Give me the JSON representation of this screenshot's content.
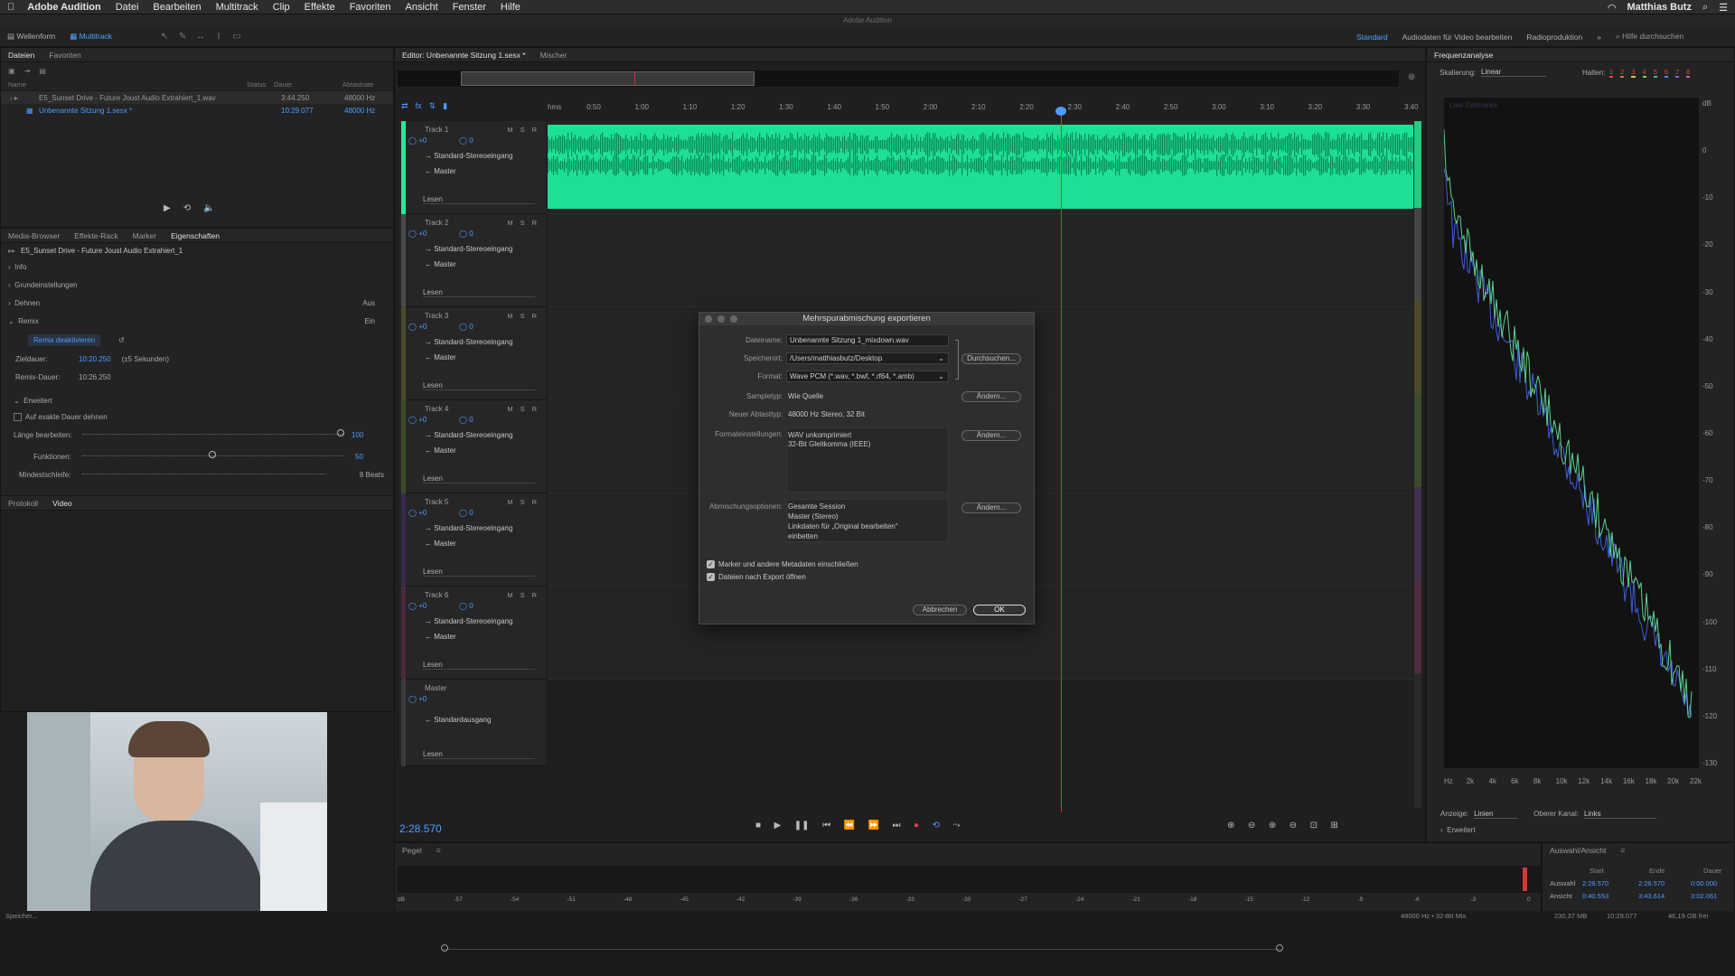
{
  "menubar": {
    "app": "Adobe Audition",
    "items": [
      "Datei",
      "Bearbeiten",
      "Multitrack",
      "Clip",
      "Effekte",
      "Favoriten",
      "Ansicht",
      "Fenster",
      "Hilfe"
    ],
    "user": "Matthias Butz"
  },
  "window_title": "Adobe Audition",
  "toolbar": {
    "waveform": "Wellenform",
    "multitrack": "Multitrack",
    "workspaces": [
      "Standard",
      "Audiodaten für Video bearbeiten",
      "Radioproduktion"
    ],
    "search_placeholder": "Hilfe durchsuchen"
  },
  "files_panel": {
    "tabs": [
      "Dateien",
      "Favoriten"
    ],
    "columns": [
      "Name",
      "Status",
      "Dauer",
      "Abtastrate"
    ],
    "rows": [
      {
        "name": "E5_Sunset Drive - Future Joust Audio Extrahiert_1.wav",
        "duration": "3:44.250",
        "rate": "48000 Hz"
      },
      {
        "name": "Unbenannte Sitzung 1.sesx *",
        "duration": "10:29.077",
        "rate": "48000 Hz"
      }
    ]
  },
  "props_panel": {
    "tabs": [
      "Media-Browser",
      "Effekte-Rack",
      "Marker",
      "Eigenschaften"
    ],
    "file": "E5_Sunset Drive - Future Joust Audio Extrahiert_1",
    "sections": [
      "Info",
      "Grundeinstellungen",
      "Dehnen",
      "Remix"
    ],
    "dehnen_value": "Aus",
    "remix_value": "Ein",
    "remix_button": "Remix deaktivieren",
    "zieldauer_label": "Zieldauer:",
    "zieldauer_value": "10:20.250",
    "zieldauer_note": "(±5 Sekunden)",
    "remixdauer_label": "Remix-Dauer:",
    "remixdauer_value": "10:26.250",
    "erweitert": "Erweitert",
    "exact_label": "Auf exakte Dauer dehnen",
    "length_label": "Länge bearbeiten:",
    "length_value": "100",
    "funktionen_label": "Funktionen:",
    "funktionen_value": "50",
    "mindest_label": "Mindestschleife:",
    "mindest_value": "8 Beats",
    "bottom_tabs": [
      "Protokoll",
      "Video"
    ]
  },
  "editor": {
    "tab": "Editor: Unbenannte Sitzung 1.sesx *",
    "mixer_tab": "Mischer",
    "ruler": [
      "hms",
      "0:50",
      "1:00",
      "1:10",
      "1:20",
      "1:30",
      "1:40",
      "1:50",
      "2:00",
      "2:10",
      "2:20",
      "2:30",
      "2:40",
      "2:50",
      "3:00",
      "3:10",
      "3:20",
      "3:30",
      "3:40"
    ],
    "tracks": [
      {
        "name": "Track 1",
        "color": "#2ee59a"
      },
      {
        "name": "Track 2",
        "color": "#4a4a4a"
      },
      {
        "name": "Track 3",
        "color": "#4a4a2a"
      },
      {
        "name": "Track 4",
        "color": "#3a4a2a"
      },
      {
        "name": "Track 5",
        "color": "#3a2a4a"
      },
      {
        "name": "Track 6",
        "color": "#4a2a3a"
      }
    ],
    "vol": "+0",
    "pan": "0",
    "input": "Standard-Stereoeingang",
    "output": "Master",
    "mode": "Lesen",
    "master_name": "Master",
    "master_output": "Standardausgang",
    "time": "2:28.570"
  },
  "dialog": {
    "title": "Mehrspurabmischung exportieren",
    "filename_label": "Dateiname:",
    "filename": "Unbenannte Sitzung 1_mixdown.wav",
    "location_label": "Speicherort:",
    "location": "/Users/matthiasbutz/Desktop",
    "browse": "Durchsuchen...",
    "format_label": "Format:",
    "format": "Wave PCM (*.wav, *.bwf, *.rf64, *.amb)",
    "sampletype_label": "Sampletyp:",
    "sampletype": "Wie Quelle",
    "newtype_label": "Neuer Abtasttyp:",
    "newtype": "48000 Hz Stereo, 32 Bit",
    "formatsettings_label": "Formateinstellungen:",
    "formatsettings": [
      "WAV unkomprimiert",
      "32-Bit Gleitkomma (IEEE)"
    ],
    "mixoptions_label": "Abmischungsoptionen:",
    "mixoptions": [
      "Gesamte Session",
      "Master (Stereo)",
      "Linkdaten für „Original bearbeiten“",
      "einbetten"
    ],
    "change": "Ändern...",
    "check1": "Marker und andere Metadaten einschließen",
    "check2": "Dateien nach Export öffnen",
    "cancel": "Abbrechen",
    "ok": "OK"
  },
  "freq_panel": {
    "title": "Frequenzanalyse",
    "scale_label": "Skalierung:",
    "scale": "Linear",
    "hold_label": "Halten:",
    "hold": [
      "1",
      "2",
      "3",
      "4",
      "5",
      "6",
      "7",
      "8"
    ],
    "db_labels": [
      "dB",
      "0",
      "-10",
      "-20",
      "-30",
      "-40",
      "-50",
      "-60",
      "-70",
      "-80",
      "-90",
      "-100",
      "-110",
      "-120",
      "-130"
    ],
    "hz_labels": [
      "Hz",
      "2k",
      "4k",
      "6k",
      "8k",
      "10k",
      "12k",
      "14k",
      "16k",
      "18k",
      "20k",
      "22k"
    ],
    "display_label": "Anzeige:",
    "display": "Linien",
    "channel_label": "Oberer Kanal:",
    "channel": "Links",
    "erweitert": "Erweitert",
    "live": "Live-Zeitmarke"
  },
  "levels": {
    "title": "Pegel",
    "scale": [
      "dB",
      "-57",
      "-54",
      "-51",
      "-48",
      "-45",
      "-42",
      "-39",
      "-36",
      "-33",
      "-30",
      "-27",
      "-24",
      "-21",
      "-18",
      "-15",
      "-12",
      "-9",
      "-6",
      "-3",
      "0"
    ]
  },
  "selection": {
    "title": "Auswahl/Ansicht",
    "headers": [
      "Start",
      "Ende",
      "Dauer"
    ],
    "rows": [
      {
        "label": "Auswahl",
        "start": "2:28.570",
        "end": "2:28.570",
        "dur": "0:00.000"
      },
      {
        "label": "Ansicht",
        "start": "0:40.553",
        "end": "3:43.614",
        "dur": "3:02.061"
      }
    ]
  },
  "status": {
    "format": "48000 Hz • 32-Bit Mix",
    "size": "230,37 MB",
    "duration": "10:29.077",
    "free": "46,19 GB frei",
    "left": "Speicher..."
  }
}
